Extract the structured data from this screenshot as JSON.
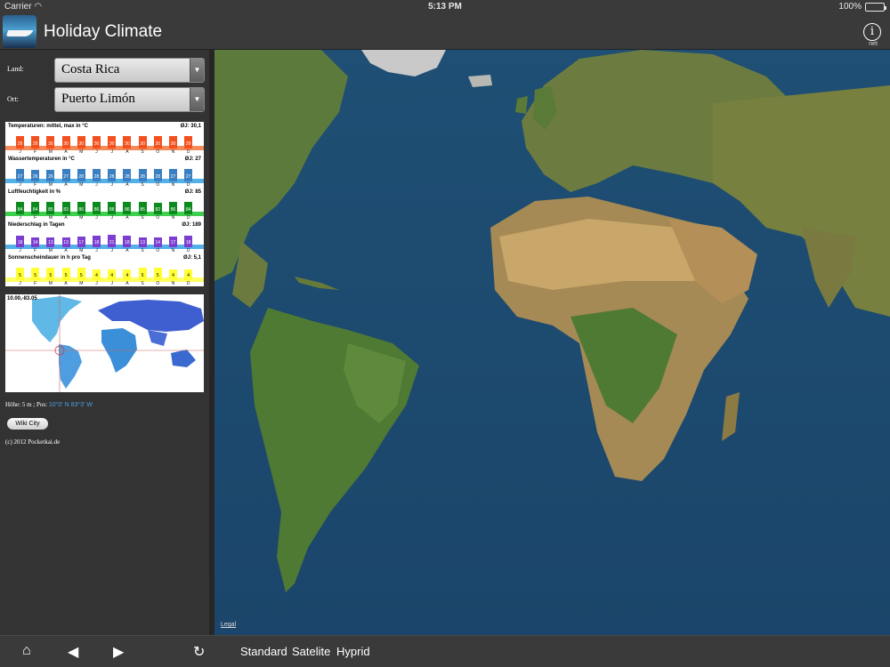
{
  "status": {
    "carrier": "Carrier",
    "time": "5:13 PM",
    "battery": "100%"
  },
  "header": {
    "title": "Holiday Climate",
    "info_label": "net"
  },
  "form": {
    "country_label": "Land:",
    "country_value": "Costa Rica",
    "city_label": "Ort:",
    "city_value": "Puerto Limón"
  },
  "climate": {
    "months": [
      "J",
      "F",
      "M",
      "A",
      "M",
      "J",
      "J",
      "A",
      "S",
      "O",
      "N",
      "D"
    ],
    "rows": [
      {
        "title": "Temperaturen: mittel, max in °C",
        "avg": "ØJ: 30,1",
        "color": "#f4501e",
        "band": "#f58a5a",
        "values": [
          29,
          29,
          30,
          30,
          30,
          30,
          30,
          30,
          30,
          30,
          30,
          29
        ]
      },
      {
        "title": "Wassertemperaturen  in °C",
        "avg": "ØJ: 27",
        "color": "#3a7fc1",
        "band": "#56b0e8",
        "values": [
          27,
          26,
          26,
          27,
          28,
          28,
          28,
          28,
          28,
          28,
          27,
          27
        ]
      },
      {
        "title": "Luftfeuchtigkeit  in %",
        "avg": "ØJ: 85",
        "color": "#0d8a1f",
        "band": "#3fcf4f",
        "values": [
          84,
          84,
          85,
          83,
          86,
          86,
          88,
          86,
          85,
          82,
          86,
          84
        ]
      },
      {
        "title": "Niederschlag in Tagen",
        "avg": "ØJ: 189",
        "color": "#7b3ed1",
        "band": "#56b0e8",
        "values": [
          18,
          14,
          13,
          13,
          17,
          18,
          21,
          18,
          13,
          14,
          17,
          18
        ]
      },
      {
        "title": "Sonnenscheindauer in h pro Tag",
        "avg": "ØJ: 5,1",
        "color": "#ffff33",
        "band": "#ffff66",
        "values": [
          5,
          5,
          5,
          5,
          5,
          4,
          4,
          4,
          5,
          5,
          4,
          4
        ]
      }
    ]
  },
  "location": {
    "coords": "10.00,-83.05",
    "height_text": "Höhe: 5 m ; Pos:",
    "position": "10°0' N 83°3' W"
  },
  "wiki_button": "Wiki City",
  "copyright": "(c) 2012 Pocketkai.de",
  "map": {
    "legal": "Legal"
  },
  "toolbar": {
    "standard": "Standard",
    "satellite": "Satelite",
    "hybrid": "Hyprid"
  }
}
